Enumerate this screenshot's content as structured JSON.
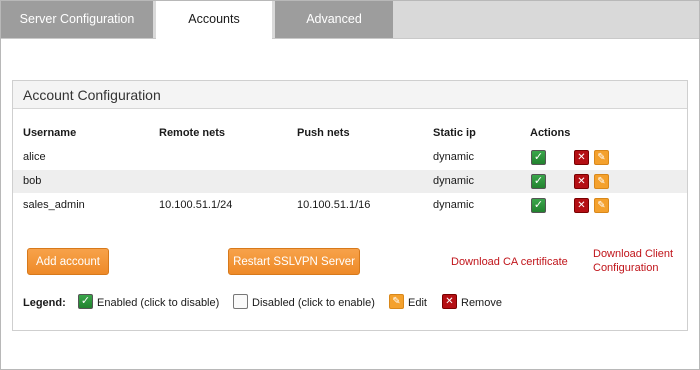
{
  "tabs": [
    {
      "label": "Server Configuration"
    },
    {
      "label": "Accounts"
    },
    {
      "label": "Advanced"
    }
  ],
  "active_tab": "Accounts",
  "panel": {
    "title": "Account Configuration"
  },
  "table": {
    "headers": [
      "Username",
      "Remote nets",
      "Push nets",
      "Static ip",
      "Actions"
    ],
    "rows": [
      {
        "username": "alice",
        "remote_nets": "",
        "push_nets": "",
        "static_ip": "dynamic",
        "enabled": true
      },
      {
        "username": "bob",
        "remote_nets": "",
        "push_nets": "",
        "static_ip": "dynamic",
        "enabled": true
      },
      {
        "username": "sales_admin",
        "remote_nets": "10.100.51.1/24",
        "push_nets": "10.100.51.1/16",
        "static_ip": "dynamic",
        "enabled": true
      }
    ]
  },
  "buttons": {
    "add_account": "Add account",
    "restart_server": "Restart SSLVPN Server"
  },
  "links": {
    "download_ca": "Download CA certificate",
    "download_client_line1": "Download Client",
    "download_client_line2": "Configuration"
  },
  "legend": {
    "label": "Legend:",
    "enabled": "Enabled (click to disable)",
    "disabled": "Disabled (click to enable)",
    "edit": "Edit",
    "remove": "Remove"
  },
  "icons": {
    "enabled": "checkbox-checked-icon",
    "disabled": "checkbox-empty-icon",
    "edit": "pencil-icon",
    "remove": "delete-x-icon"
  },
  "colors": {
    "accent": "#f09030",
    "link": "#c0141a",
    "tab_inactive": "#9d9d9d",
    "check_green": "#2b9a3c",
    "remove_red": "#b40f14"
  }
}
